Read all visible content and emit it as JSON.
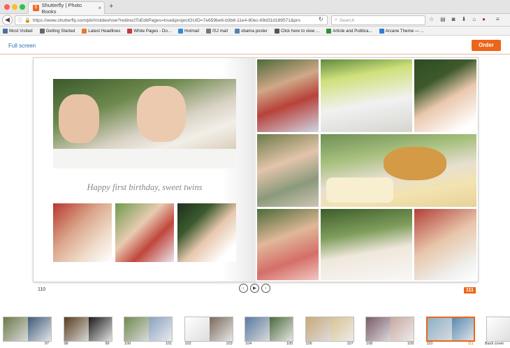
{
  "browser": {
    "tab_title": "Shutterfly | Photo Books",
    "tab_close": "×",
    "new_tab": "+",
    "url": "https://www.shutterfly.com/pb/#/slideshow?redirectToEditPages=true&projectGUID=7e659be6-b3b8-11e4-80ec-69d31d189571&pro",
    "search_placeholder": "Search",
    "bookmarks": [
      {
        "label": "Most Visited",
        "color": "#4a6fa5"
      },
      {
        "label": "Getting Started",
        "color": "#666"
      },
      {
        "label": "Latest Headlines",
        "color": "#e8792b"
      },
      {
        "label": "White Pages - Do...",
        "color": "#c23b3b"
      },
      {
        "label": "Hotmail",
        "color": "#2e8bd8"
      },
      {
        "label": "ISJ mail",
        "color": "#777"
      },
      {
        "label": "obama poster",
        "color": "#5b7fb5"
      },
      {
        "label": "Click here to view ...",
        "color": "#555"
      },
      {
        "label": "Article and Publica...",
        "color": "#2f8f3a"
      },
      {
        "label": "Arcane Theme — ...",
        "color": "#2d7fd3"
      }
    ]
  },
  "app": {
    "full_screen_label": "Full screen",
    "order_label": "Order"
  },
  "book": {
    "caption": "Happy first birthday, sweet twins",
    "left_page_number": "110",
    "right_page_number": "111"
  },
  "pager": {
    "prev": "‹",
    "play": "▶",
    "next": "›"
  },
  "thumbnails": [
    {
      "left": "",
      "right": "97"
    },
    {
      "left": "98",
      "right": "99"
    },
    {
      "left": "100",
      "right": "101"
    },
    {
      "left": "102",
      "right": "103"
    },
    {
      "left": "104",
      "right": "105"
    },
    {
      "left": "106",
      "right": "107"
    },
    {
      "left": "108",
      "right": "109"
    },
    {
      "left": "110",
      "right": "111"
    },
    {
      "left": "",
      "right": "Back cover"
    }
  ]
}
